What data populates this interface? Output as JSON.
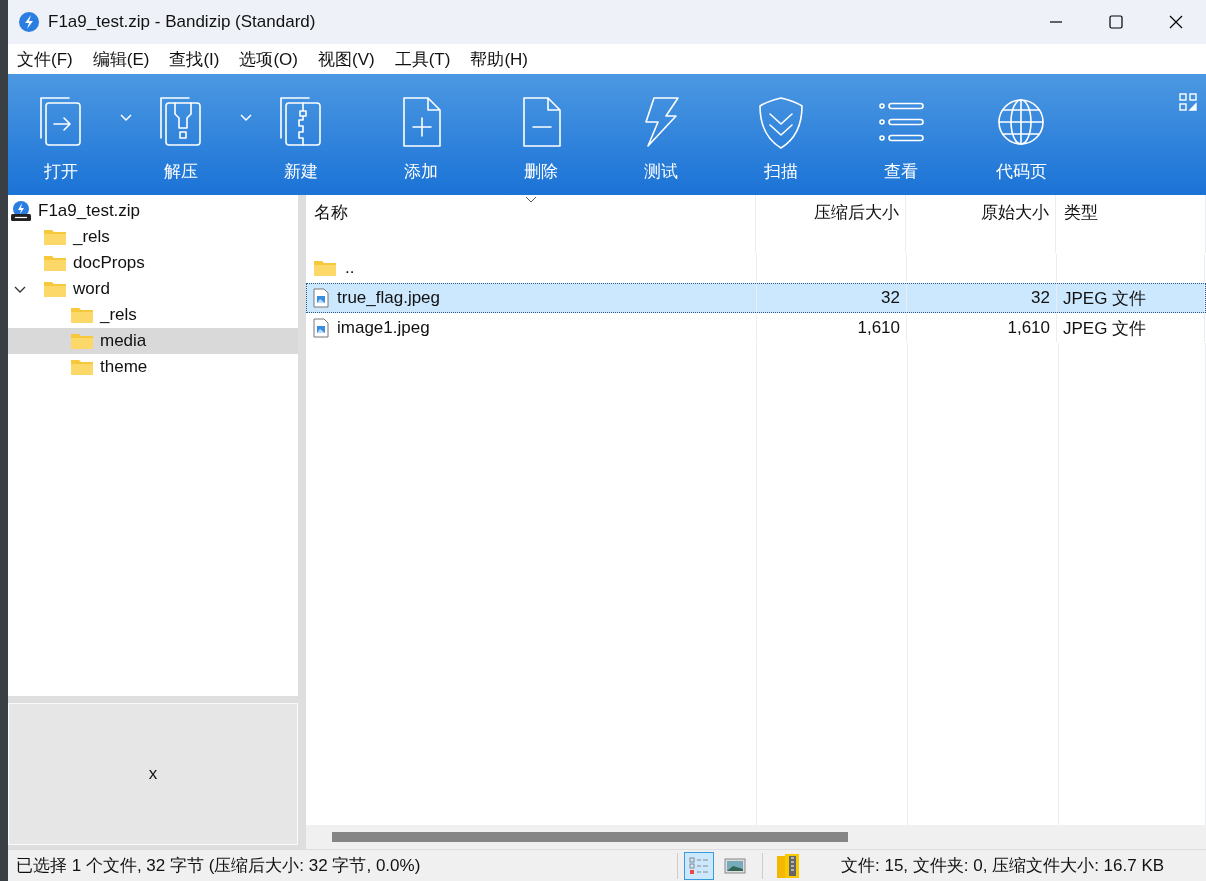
{
  "window": {
    "title": "F1a9_test.zip - Bandizip (Standard)"
  },
  "menu": [
    "文件(F)",
    "编辑(E)",
    "查找(I)",
    "选项(O)",
    "视图(V)",
    "工具(T)",
    "帮助(H)"
  ],
  "toolbar": [
    {
      "label": "打开",
      "has_menu": true
    },
    {
      "label": "解压",
      "has_menu": true
    },
    {
      "label": "新建",
      "has_menu": false
    },
    {
      "label": "添加",
      "has_menu": false
    },
    {
      "label": "删除",
      "has_menu": false
    },
    {
      "label": "测试",
      "has_menu": false
    },
    {
      "label": "扫描",
      "has_menu": false
    },
    {
      "label": "查看",
      "has_menu": false
    },
    {
      "label": "代码页",
      "has_menu": false
    }
  ],
  "tree": [
    {
      "label": "F1a9_test.zip",
      "kind": "archive",
      "selected": false,
      "children": [
        {
          "label": "_rels",
          "kind": "folder",
          "selected": false
        },
        {
          "label": "docProps",
          "kind": "folder",
          "selected": false
        },
        {
          "label": "word",
          "kind": "folder",
          "selected": false,
          "expanded": true,
          "children": [
            {
              "label": "_rels",
              "kind": "folder",
              "selected": false
            },
            {
              "label": "media",
              "kind": "folder",
              "selected": true
            },
            {
              "label": "theme",
              "kind": "folder",
              "selected": false
            }
          ]
        }
      ]
    }
  ],
  "preview": {
    "text": "x"
  },
  "table": {
    "columns": [
      {
        "label": "名称",
        "sorted": true
      },
      {
        "label": "压缩后大小",
        "sorted": false
      },
      {
        "label": "原始大小",
        "sorted": false
      },
      {
        "label": "类型",
        "sorted": false
      }
    ],
    "rows": [
      {
        "kind": "parent",
        "name": "..",
        "selected": false
      },
      {
        "kind": "image",
        "name": "true_flag.jpeg",
        "compressed": "32",
        "original": "32",
        "type": "JPEG 文件",
        "selected": true
      },
      {
        "kind": "image",
        "name": "image1.jpeg",
        "compressed": "1,610",
        "original": "1,610",
        "type": "JPEG 文件",
        "selected": false
      }
    ]
  },
  "status_bar": {
    "selection": "已选择 1 个文件, 32 字节 (压缩后大小: 32 字节, 0.0%)",
    "view_modes": [
      {
        "selected": true
      },
      {
        "selected": false
      }
    ],
    "summary": "文件: 15, 文件夹: 0, 压缩文件大小: 16.7 KB"
  }
}
